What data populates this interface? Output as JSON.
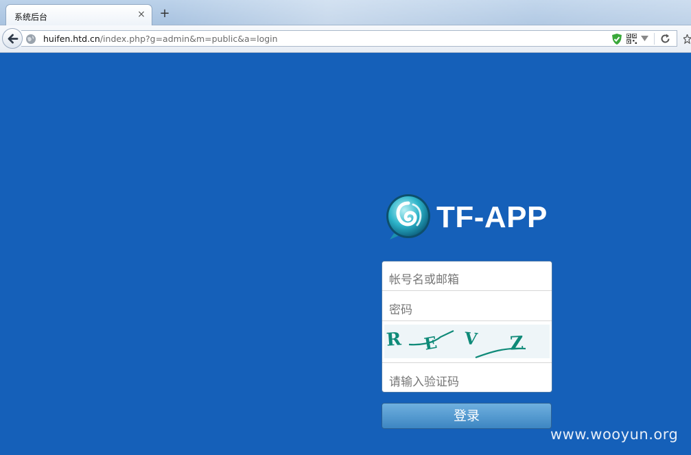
{
  "browser": {
    "tab_title": "系统后台",
    "tab_close": "×",
    "new_tab": "+",
    "url_host": "huifen.htd.cn",
    "url_path": "/index.php?g=admin&m=public&a=login"
  },
  "page": {
    "logo_text": "TF-APP",
    "form": {
      "username_placeholder": "帐号名或邮箱",
      "password_placeholder": "密码",
      "captcha_chars": [
        "R",
        "E",
        "V",
        "Z"
      ],
      "captcha_placeholder": "请输入验证码"
    },
    "login_button": "登录"
  },
  "watermark": "www.wooyun.org",
  "colors": {
    "page_background": "#1560b9",
    "button": "#4a93cd",
    "captcha_text": "#0f8a78"
  }
}
